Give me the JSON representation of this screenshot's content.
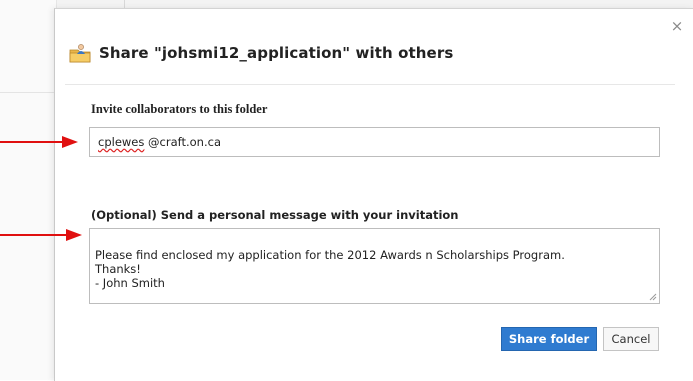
{
  "dialog": {
    "title": "Share \"johsmi12_application\" with others",
    "close_glyph": "×",
    "invite": {
      "label": "Invite collaborators to this folder",
      "value_misspelled_part": "cplewes",
      "value_rest": " @craft.on.ca"
    },
    "message": {
      "label": "(Optional) Send a personal message with your invitation",
      "value": "Please find enclosed my application for the 2012 Awards n Scholarships Program.\nThanks!\n- John Smith"
    },
    "buttons": {
      "share": "Share folder",
      "cancel": "Cancel"
    }
  },
  "colors": {
    "primary_button": "#2f7bd0",
    "annotation_arrow": "#e01010",
    "misspelling_underline": "#d22222"
  },
  "icons": {
    "header": "shared-folder-icon",
    "close": "close-icon",
    "resize": "resize-grip-icon",
    "annotation": "red-arrow-icon"
  }
}
